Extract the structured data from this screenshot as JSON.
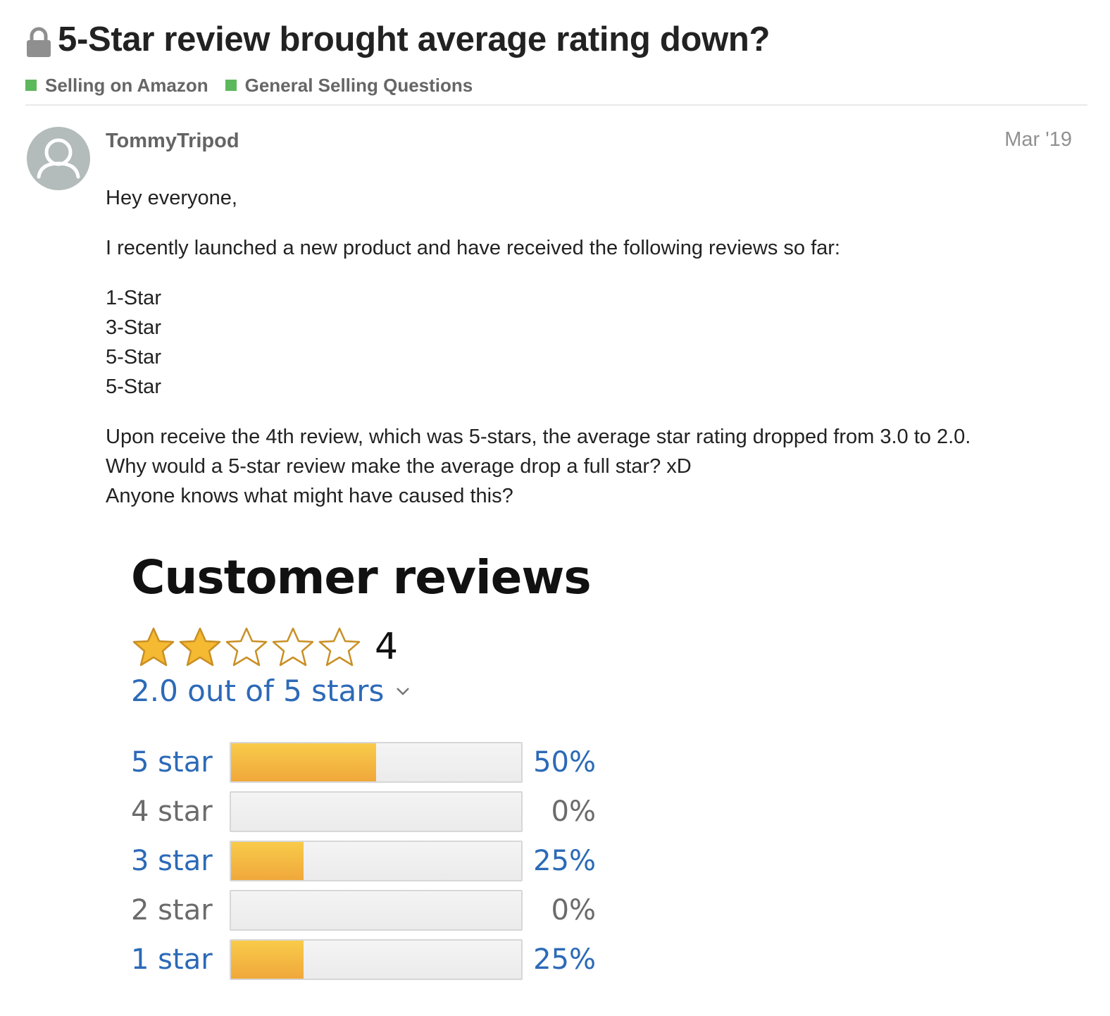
{
  "topic": {
    "title": "5-Star review brought average rating down?",
    "lock_icon": "lock-icon",
    "categories": [
      {
        "label": "Selling on Amazon",
        "color": "#5cb85c"
      },
      {
        "label": "General Selling Questions",
        "color": "#5cb85c"
      }
    ]
  },
  "post": {
    "username": "TommyTripod",
    "date": "Mar '19",
    "avatar_icon": "user-icon",
    "greeting": "Hey everyone,",
    "intro": "I recently launched a new product and have received the following reviews so far:",
    "reviews_list": [
      "1-Star",
      "3-Star",
      "5-Star",
      "5-Star"
    ],
    "closing_lines": [
      "Upon receive the 4th review, which was 5-stars, the average star rating dropped from 3.0 to 2.0.",
      "Why would a 5-star review make the average drop a full star? xD",
      "Anyone knows what might have caused this?"
    ]
  },
  "screenshot": {
    "title": "Customer reviews",
    "star_rating": 2,
    "star_max": 5,
    "total_count": "4",
    "average_text": "2.0 out of 5 stars",
    "link_color": "#2c6ab7",
    "bar_color": "#f0a83b",
    "histogram": [
      {
        "label": "5 star",
        "percent_text": "50%",
        "percent": 50,
        "link": true
      },
      {
        "label": "4 star",
        "percent_text": "0%",
        "percent": 0,
        "link": false
      },
      {
        "label": "3 star",
        "percent_text": "25%",
        "percent": 25,
        "link": true
      },
      {
        "label": "2 star",
        "percent_text": "0%",
        "percent": 0,
        "link": false
      },
      {
        "label": "1 star",
        "percent_text": "25%",
        "percent": 25,
        "link": true
      }
    ]
  }
}
